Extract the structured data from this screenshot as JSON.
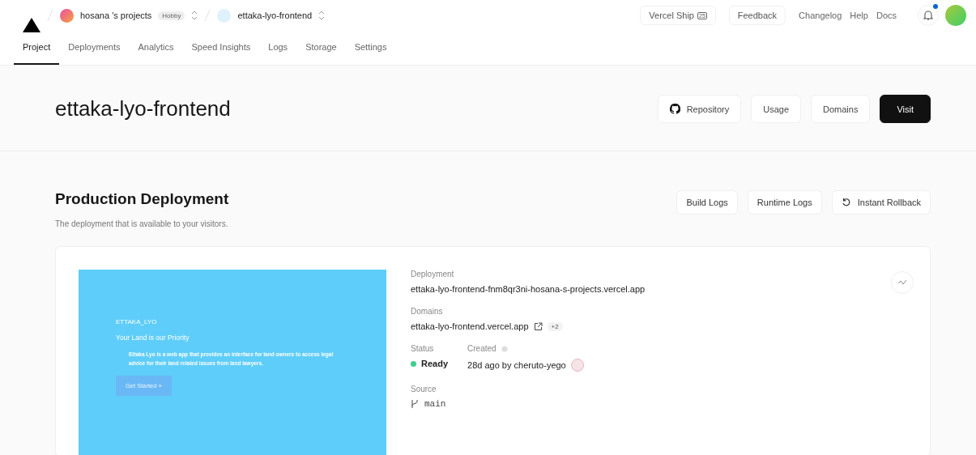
{
  "topbar": {
    "team": {
      "name": "hosana 's projects",
      "plan": "Hobby"
    },
    "project": {
      "name": "ettaka-lyo-frontend"
    },
    "links": [
      {
        "label": "Vercel Ship",
        "kind": "outlined",
        "badge": "25"
      },
      {
        "label": "Feedback",
        "kind": "outlined"
      },
      {
        "label": "Changelog",
        "kind": "plain"
      },
      {
        "label": "Help",
        "kind": "plain"
      },
      {
        "label": "Docs",
        "kind": "plain"
      }
    ]
  },
  "tabs": [
    {
      "label": "Project",
      "selected": true
    },
    {
      "label": "Deployments",
      "selected": false
    },
    {
      "label": "Analytics",
      "selected": false
    },
    {
      "label": "Speed Insights",
      "selected": false
    },
    {
      "label": "Logs",
      "selected": false
    },
    {
      "label": "Storage",
      "selected": false
    },
    {
      "label": "Settings",
      "selected": false
    }
  ],
  "header": {
    "title": "ettaka-lyo-frontend",
    "buttons": [
      {
        "label": "Repository",
        "kind": "github"
      },
      {
        "label": "Usage",
        "kind": "plain"
      },
      {
        "label": "Domains",
        "kind": "plain"
      },
      {
        "label": "Visit",
        "kind": "primary"
      }
    ]
  },
  "production": {
    "title": "Production Deployment",
    "subtitle": "The deployment that is available to your visitors.",
    "buttons": [
      {
        "label": "Build Logs",
        "kind": "plain"
      },
      {
        "label": "Runtime Logs",
        "kind": "plain"
      },
      {
        "label": "Instant Rollback",
        "kind": "rollback"
      }
    ],
    "preview": {
      "brand": "ETTAKA_LYO",
      "tagline": "Your Land is our Priority",
      "text": "Ettaka Lyo is a web app that provides an interface for land owners to access legal advice for their land related issues from land lawyers.",
      "cta": "Get Started »"
    },
    "deployment_label": "Deployment",
    "deployment": "ettaka-lyo-frontend-fnm8qr3ni-hosana-s-projects.vercel.app",
    "domains_label": "Domains",
    "domain": "ettaka-lyo-frontend.vercel.app",
    "domains_more": "+2",
    "status_label": "Status",
    "status": {
      "label": "Ready",
      "color": "#3ecf8e"
    },
    "created_label": "Created",
    "created": "28d ago by cheruto-yego",
    "source_label": "Source",
    "branch": "main"
  }
}
